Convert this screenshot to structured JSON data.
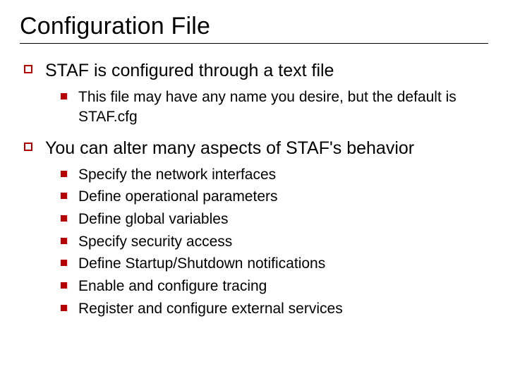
{
  "title": "Configuration File",
  "items": [
    {
      "text": "STAF is configured through a text file",
      "children": [
        {
          "text": "This file may have any name you desire, but the default is STAF.cfg"
        }
      ]
    },
    {
      "text": "You can alter many aspects of STAF's behavior",
      "children": [
        {
          "text": "Specify the network interfaces"
        },
        {
          "text": "Define operational parameters"
        },
        {
          "text": "Define global variables"
        },
        {
          "text": "Specify security access"
        },
        {
          "text": "Define Startup/Shutdown notifications"
        },
        {
          "text": "Enable and configure tracing"
        },
        {
          "text": "Register and configure external services"
        }
      ]
    }
  ]
}
